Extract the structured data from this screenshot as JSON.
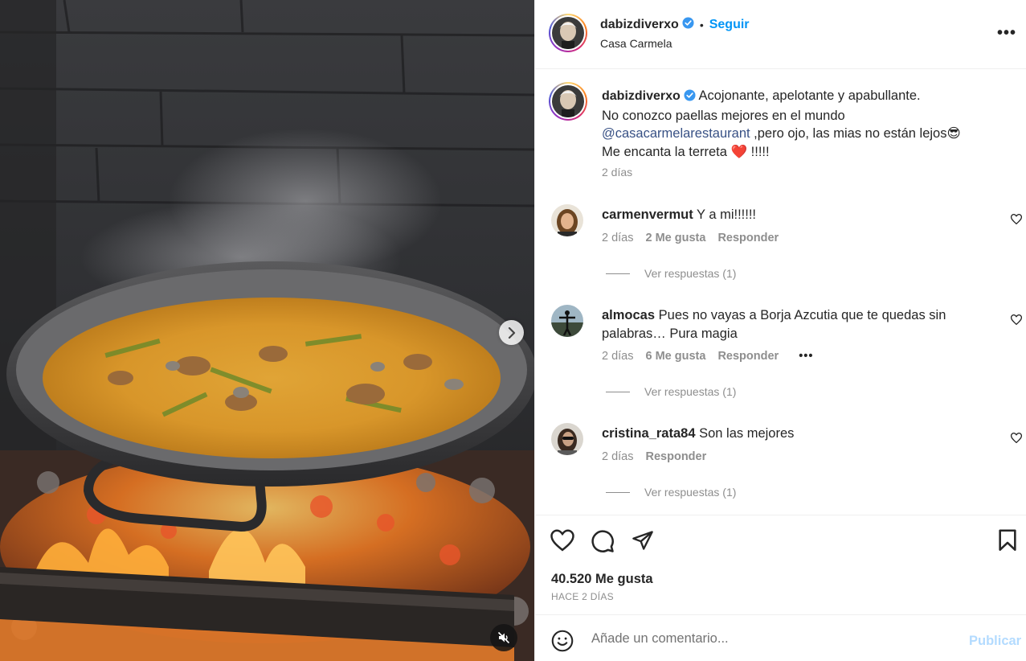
{
  "post": {
    "author": "dabizdiverxo",
    "follow_label": "Seguir",
    "separator": "•",
    "location": "Casa Carmela",
    "more_label": "•••"
  },
  "caption": {
    "username": "dabizdiverxo",
    "line1": "Acojonante, apelotante y apabullante.",
    "line2": "No conozco paellas mejores en el mundo",
    "mention": "@casacarmelarestaurant",
    "line3_rest": " ,pero ojo, las mias no están lejos",
    "line3_emoji": "😎",
    "line4": "Me encanta la terreta",
    "line4_emoji": "❤️",
    "line4_rest": " !!!!!",
    "time": "2 días"
  },
  "comments": [
    {
      "username": "carmenvermut",
      "text": "Y a mi!!!!!!",
      "time": "2 días",
      "likes": "2 Me gusta",
      "reply_label": "Responder",
      "replies_label": "Ver respuestas (1)"
    },
    {
      "username": "almocas",
      "text": "Pues no vayas a Borja Azcutia que te quedas sin palabras… Pura magia",
      "time": "2 días",
      "likes": "6 Me gusta",
      "reply_label": "Responder",
      "options_label": "•••",
      "replies_label": "Ver respuestas (1)"
    },
    {
      "username": "cristina_rata84",
      "text": "Son las mejores",
      "time": "2 días",
      "reply_label": "Responder",
      "replies_label": "Ver respuestas (1)"
    }
  ],
  "actions": {
    "like_icon": "heart-icon",
    "comment_icon": "comment-bubble-icon",
    "share_icon": "paper-plane-icon",
    "save_icon": "bookmark-icon",
    "likes_count": "40.520 Me gusta",
    "posted_ago": "HACE 2 DÍAS"
  },
  "add_comment": {
    "placeholder": "Añade un comentario...",
    "publish_label": "Publicar"
  },
  "colors": {
    "link_blue": "#0095f6",
    "mention_blue": "#385185",
    "muted_text": "#8e8e8e",
    "publish_disabled": "#b3dbff",
    "verified_blue": "#3897f0"
  }
}
